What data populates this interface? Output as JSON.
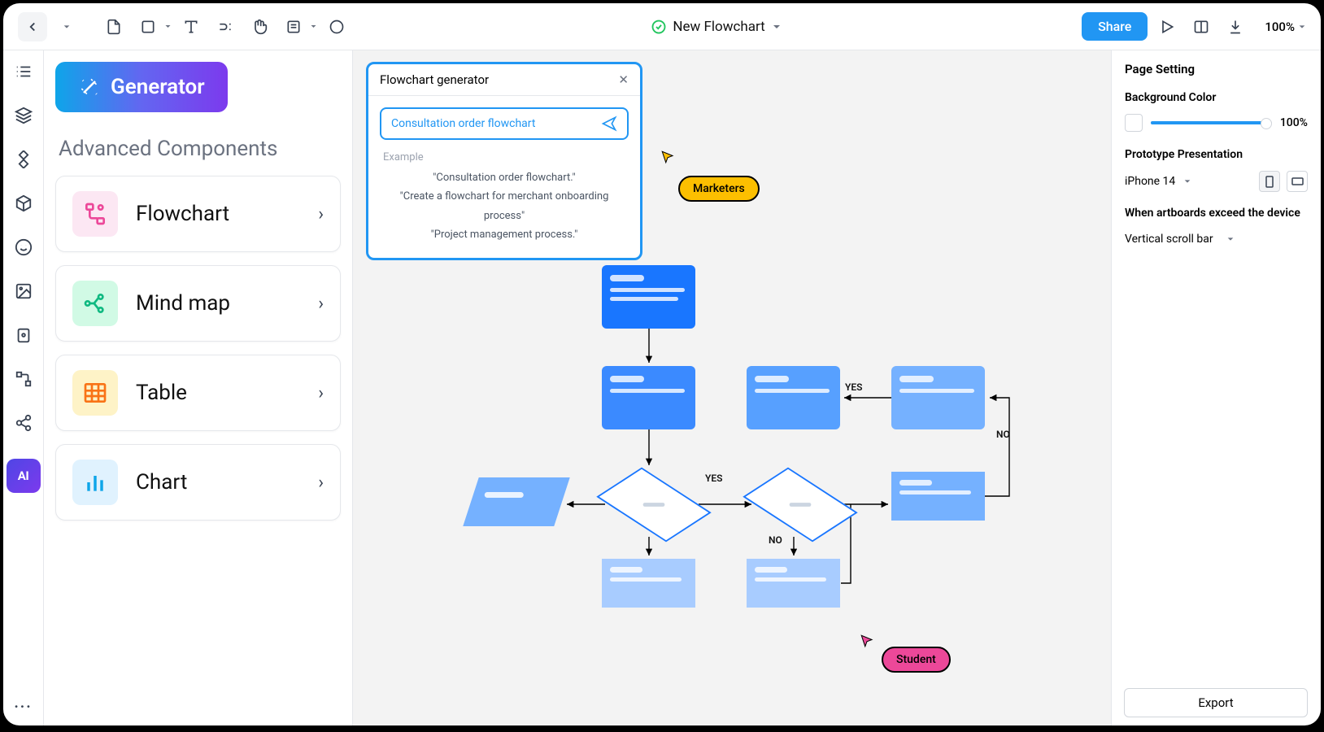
{
  "topbar": {
    "title": "New Flowchart",
    "share": "Share",
    "zoom": "100%"
  },
  "iconrail": {
    "ai": "AI"
  },
  "leftpanel": {
    "generator_btn": "Generator",
    "advanced_heading": "Advanced Components",
    "items": {
      "flowchart": "Flowchart",
      "mindmap": "Mind map",
      "table": "Table",
      "chart": "Chart"
    }
  },
  "genpanel": {
    "title": "Flowchart generator",
    "input_value": "Consultation order flowchart",
    "example_label": "Example",
    "ex1": "\"Consultation order flowchart.\"",
    "ex2": "\"Create a flowchart for merchant onboarding process\"",
    "ex3": "\"Project management process.\""
  },
  "cursors": {
    "marketers": "Marketers",
    "student": "Student"
  },
  "flow_labels": {
    "yes": "YES",
    "no": "NO"
  },
  "rightpanel": {
    "title": "Page Setting",
    "bg_heading": "Background Color",
    "bg_pct": "100%",
    "proto_heading": "Prototype Presentation",
    "device": "iPhone 14",
    "exceed_text": "When artboards exceed the device",
    "scroll_option": "Vertical scroll bar",
    "export": "Export"
  }
}
